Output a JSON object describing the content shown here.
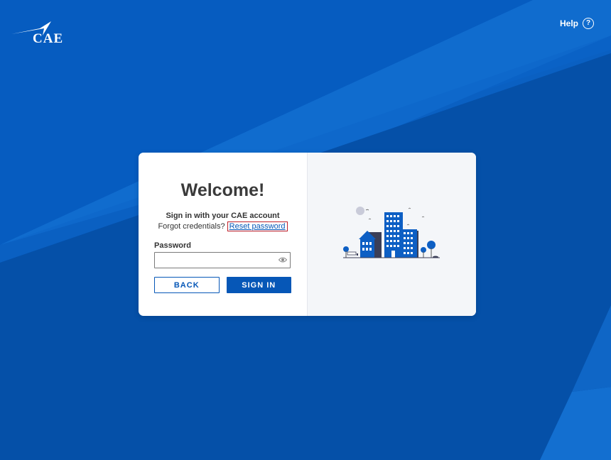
{
  "header": {
    "logo_text": "CAE",
    "help_label": "Help",
    "help_icon": "question-circle-icon"
  },
  "login": {
    "title": "Welcome!",
    "subtitle": "Sign in with your CAE account",
    "forgot_prefix": "Forgot credentials?",
    "reset_link": "Reset password",
    "password_label": "Password",
    "password_value": "",
    "password_placeholder": "",
    "back_label": "BACK",
    "signin_label": "SIGN IN"
  },
  "colors": {
    "brand_blue": "#0657b7",
    "link_highlight": "#c0212b",
    "card_bg": "#ffffff",
    "panel_bg": "#f4f6f9"
  },
  "icons": {
    "password_toggle": "eye-icon",
    "illustration": "city-buildings-illustration"
  }
}
